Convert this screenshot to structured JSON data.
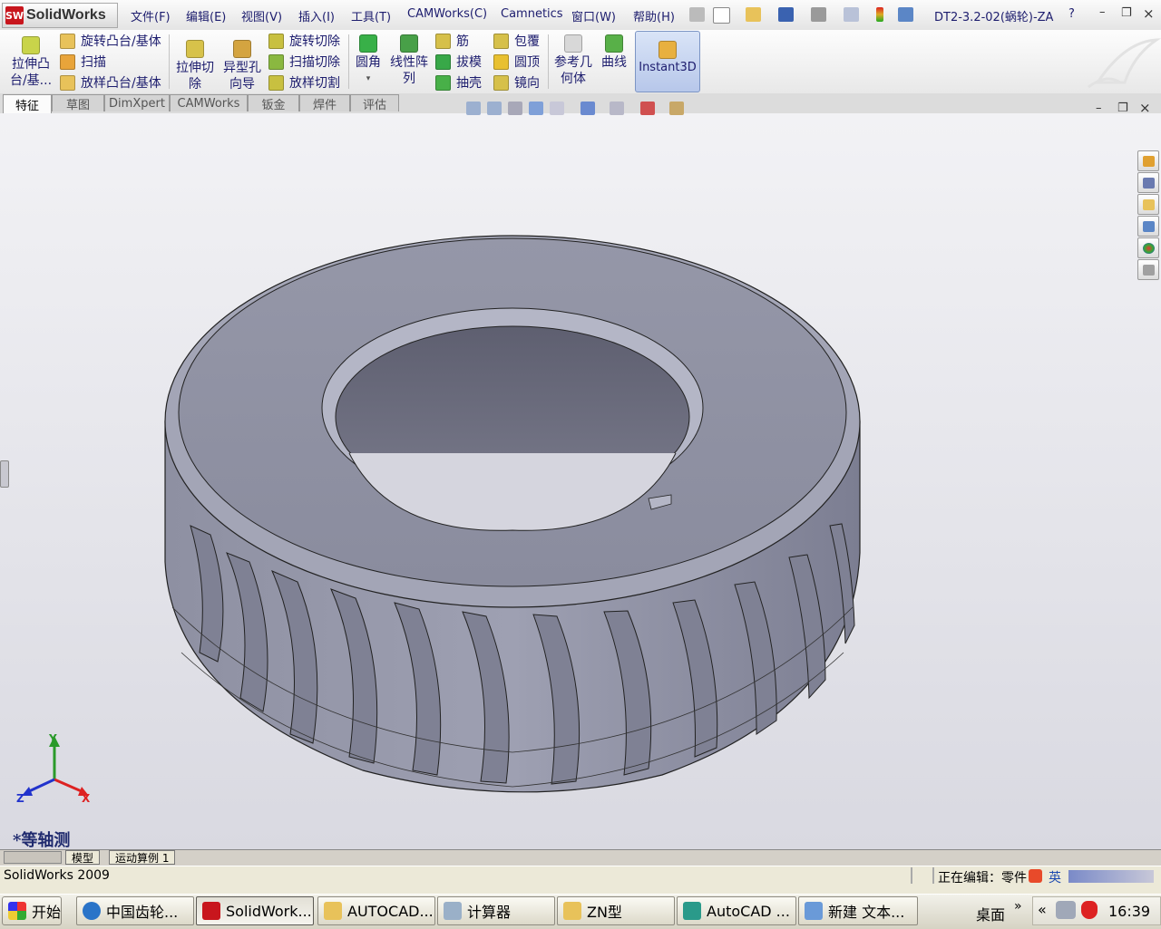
{
  "app": {
    "name": "SolidWorks",
    "logo_text": "SW"
  },
  "menu": [
    "文件(F)",
    "编辑(E)",
    "视图(V)",
    "插入(I)",
    "工具(T)",
    "CAMWorks(C)",
    "Camnetics",
    "窗口(W)",
    "帮助(H)"
  ],
  "document_title": "DT2-3.2-02(蜗轮)-ZA",
  "window_controls": {
    "help": "?",
    "minimize": "–",
    "restore": "❐",
    "close": "×"
  },
  "ribbon": {
    "extrude_boss": "拉伸凸台/基...",
    "revolve_boss": "旋转凸台/基体",
    "sweep": "扫描",
    "loft_boss": "放样凸台/基体",
    "extrude_cut": "拉伸切除",
    "hole_wizard": "异型孔向导",
    "revolve_cut": "旋转切除",
    "sweep_cut": "扫描切除",
    "loft_cut": "放样切割",
    "fillet": "圆角",
    "linear_pattern": "线性阵列",
    "rib": "筋",
    "draft": "拔模",
    "shell": "抽壳",
    "wrap": "包覆",
    "dome": "圆顶",
    "mirror": "镜向",
    "ref_geometry": "参考几何体",
    "curves": "曲线",
    "instant3d": "Instant3D"
  },
  "tabs": [
    {
      "label": "特征",
      "active": true
    },
    {
      "label": "草图",
      "active": false
    },
    {
      "label": "DimXpert",
      "active": false
    },
    {
      "label": "CAMWorks",
      "active": false
    },
    {
      "label": "钣金",
      "active": false
    },
    {
      "label": "焊件",
      "active": false
    },
    {
      "label": "评估",
      "active": false
    }
  ],
  "viewport": {
    "view_name": "*等轴测",
    "axes": {
      "x": "X",
      "y": "Y",
      "z": "Z"
    }
  },
  "bottom_tabs": [
    "模型",
    "运动算例 1"
  ],
  "status": {
    "left": "SolidWorks 2009",
    "right": "正在编辑：零件"
  },
  "taskbar": {
    "start": "开始",
    "items": [
      {
        "label": "中国齿轮...",
        "active": false
      },
      {
        "label": "SolidWork...",
        "active": true
      },
      {
        "label": "AUTOCAD...",
        "active": false
      },
      {
        "label": "计算器",
        "active": false
      },
      {
        "label": "ZN型",
        "active": false
      },
      {
        "label": "AutoCAD ...",
        "active": false
      },
      {
        "label": "新建 文本...",
        "active": false
      }
    ],
    "desktop": "桌面",
    "ime": "英",
    "clock": "16:39"
  },
  "colors": {
    "accent": "#c8161d",
    "part": "#8a8ca0",
    "viewport_top": "#f2f2f5",
    "viewport_bottom": "#d9d9e1"
  }
}
